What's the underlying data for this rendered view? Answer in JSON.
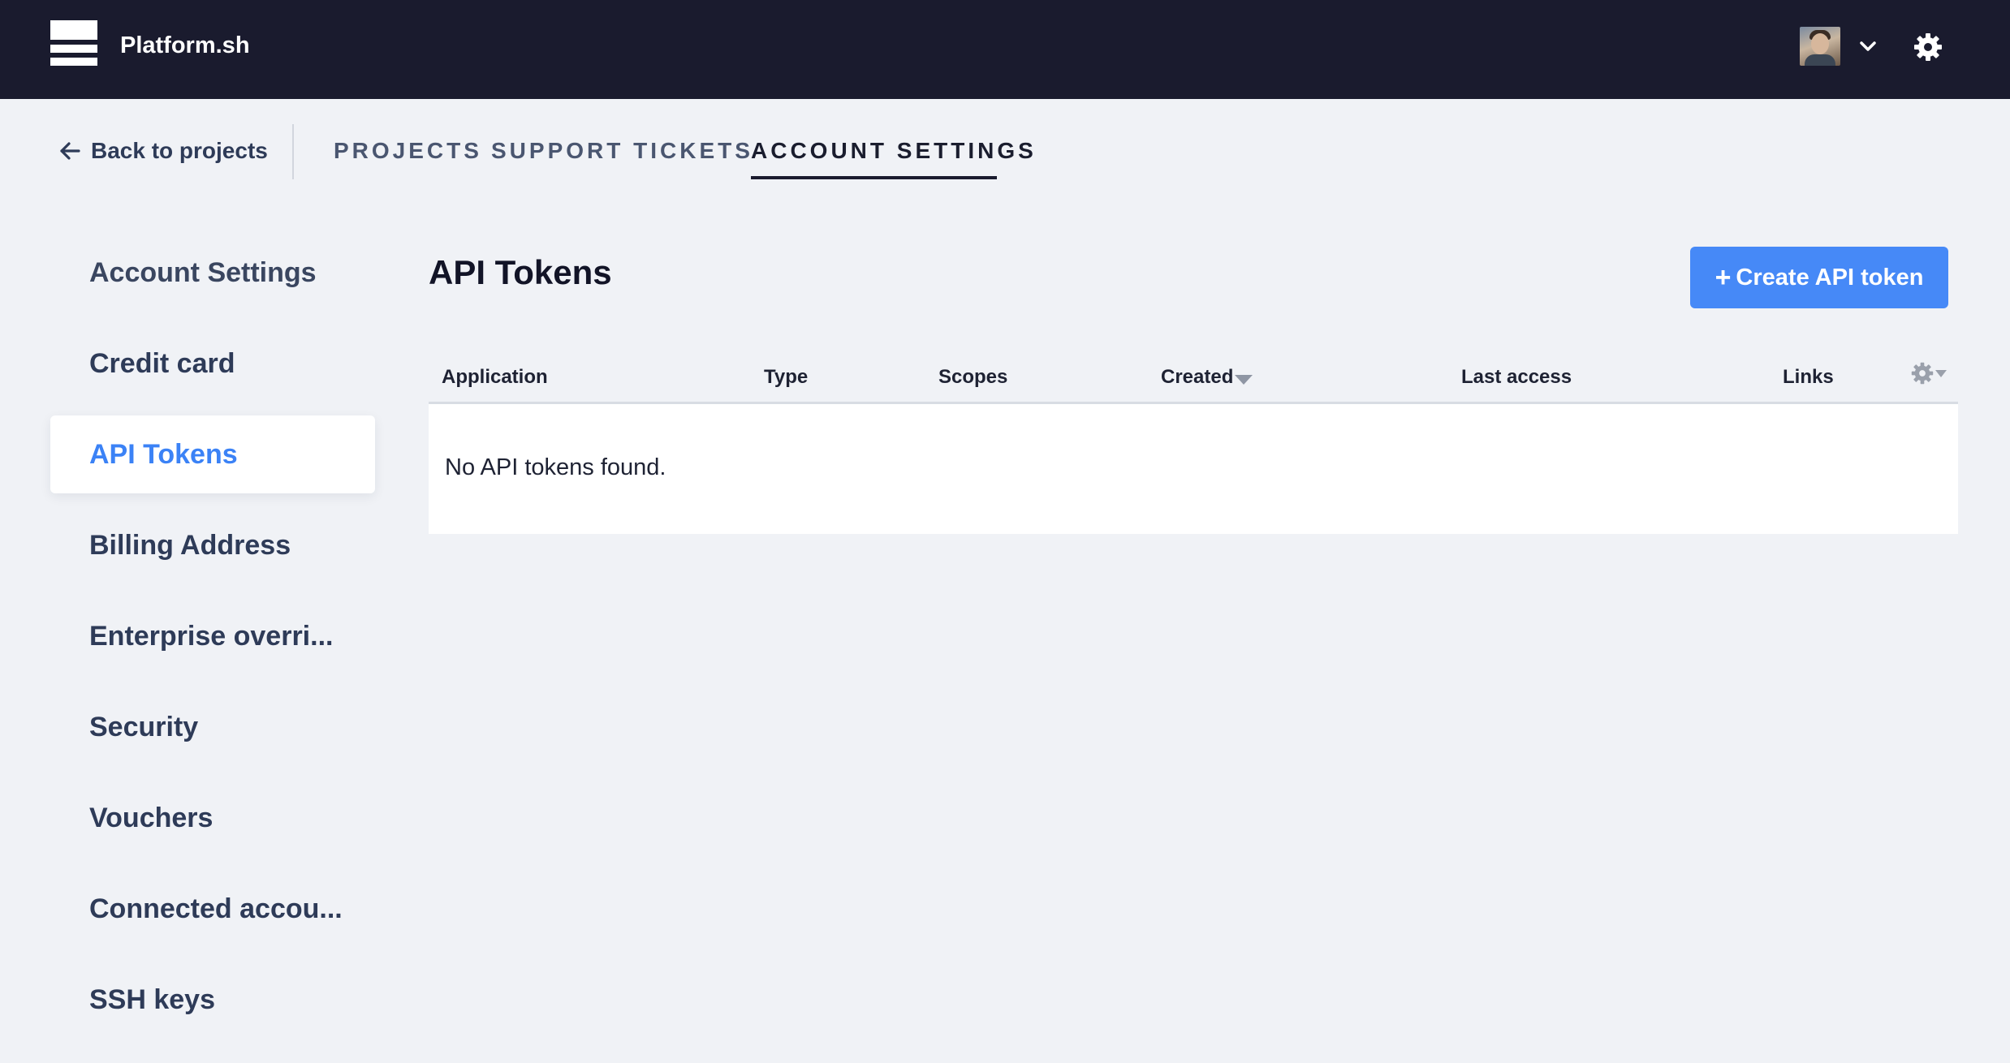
{
  "header": {
    "brand": "Platform.sh",
    "logo_icon": "platform-logo-icon",
    "avatar_icon": "user-avatar",
    "chevron_icon": "chevron-down-icon",
    "settings_icon": "gear-icon",
    "colors": {
      "bar": "#1a1b2e",
      "accent": "#4689f7"
    }
  },
  "nav": {
    "back_label": "Back to projects",
    "tabs": [
      {
        "label": "PROJECTS",
        "active": false
      },
      {
        "label": "SUPPORT TICKETS",
        "active": false
      },
      {
        "label": "ACCOUNT SETTINGS",
        "active": true
      }
    ]
  },
  "sidebar": {
    "items": [
      {
        "label": "Account Settings",
        "active": false
      },
      {
        "label": "Credit card",
        "active": false
      },
      {
        "label": "API Tokens",
        "active": true
      },
      {
        "label": "Billing Address",
        "active": false
      },
      {
        "label": "Enterprise overri...",
        "active": false
      },
      {
        "label": "Security",
        "active": false
      },
      {
        "label": "Vouchers",
        "active": false
      },
      {
        "label": "Connected accou...",
        "active": false
      },
      {
        "label": "SSH keys",
        "active": false
      }
    ]
  },
  "main": {
    "title": "API Tokens",
    "create_button": {
      "plus": "+",
      "label": "Create API token"
    },
    "table": {
      "columns": [
        "Application",
        "Type",
        "Scopes",
        "Created",
        "Last access",
        "Links"
      ],
      "sorted_column": "Created",
      "sort_direction": "descending",
      "empty_message": "No API tokens found."
    }
  }
}
